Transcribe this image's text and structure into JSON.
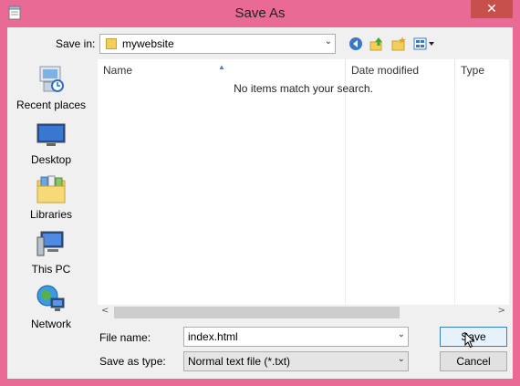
{
  "window": {
    "title": "Save As",
    "close_glyph": "✕"
  },
  "toolbar": {
    "save_in_label": "Save in:",
    "current_folder": "mywebsite",
    "back_icon": "back-arrow-icon",
    "up_icon": "up-folder-icon",
    "new_folder_icon": "new-folder-icon",
    "view_menu_icon": "view-menu-icon"
  },
  "places": [
    {
      "label": "Recent places",
      "icon": "recent-places-icon"
    },
    {
      "label": "Desktop",
      "icon": "desktop-icon"
    },
    {
      "label": "Libraries",
      "icon": "libraries-icon"
    },
    {
      "label": "This PC",
      "icon": "this-pc-icon"
    },
    {
      "label": "Network",
      "icon": "network-icon"
    }
  ],
  "file_list": {
    "columns": [
      "Name",
      "Date modified",
      "Type"
    ],
    "empty_message": "No items match your search."
  },
  "form": {
    "file_name_label": "File name:",
    "file_name_value": "index.html",
    "save_as_type_label": "Save as type:",
    "save_as_type_value": "Normal text file (*.txt)"
  },
  "buttons": {
    "save": "Save",
    "cancel": "Cancel"
  },
  "colors": {
    "frame": "#e86a95",
    "close": "#c7504c",
    "accent": "#3c7fb1"
  }
}
